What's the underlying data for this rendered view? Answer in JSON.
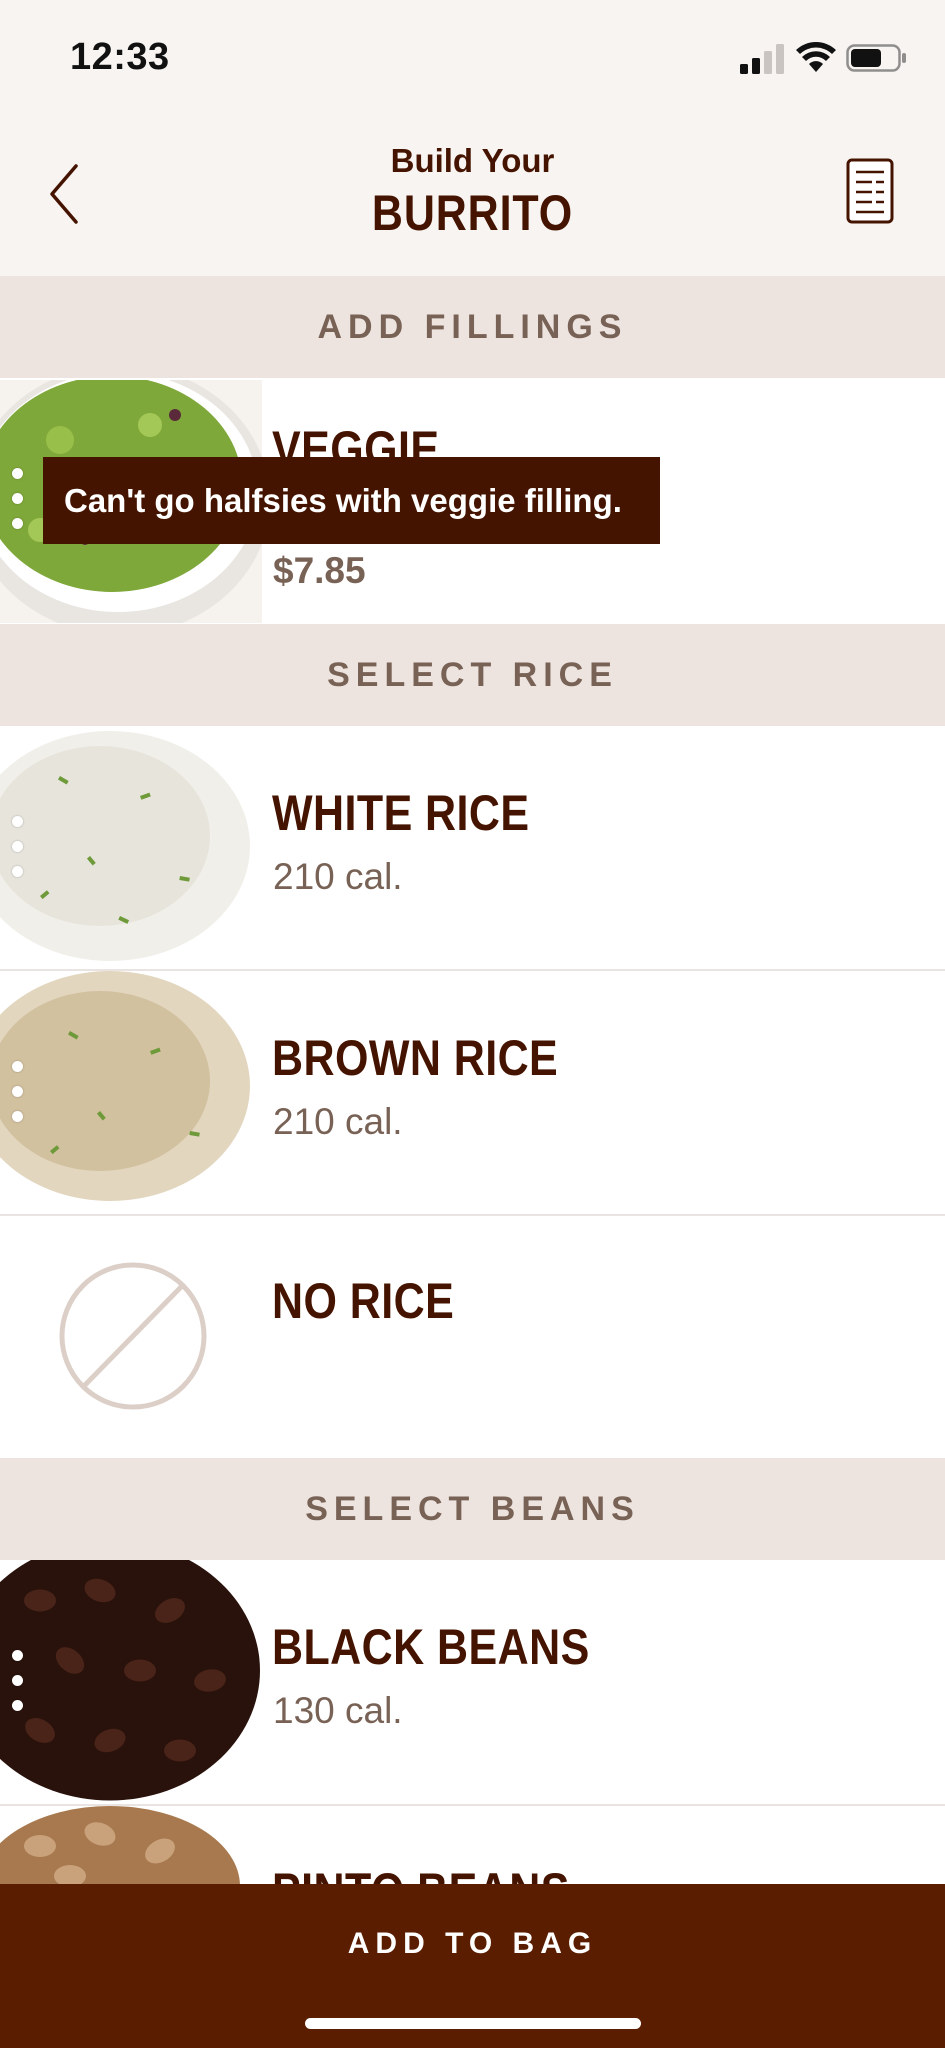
{
  "status_bar": {
    "time": "12:33"
  },
  "header": {
    "subtitle": "Build Your",
    "title": "BURRITO"
  },
  "sections": {
    "fillings": "ADD FILLINGS",
    "rice": "SELECT RICE",
    "beans": "SELECT BEANS"
  },
  "fillings": {
    "veggie": {
      "name": "VEGGIE",
      "price": "$7.85"
    }
  },
  "tooltip": {
    "text": "Can't go halfsies with veggie filling."
  },
  "rice": {
    "white": {
      "name": "WHITE RICE",
      "cal": "210 cal."
    },
    "brown": {
      "name": "BROWN RICE",
      "cal": "210 cal."
    },
    "none": {
      "name": "NO RICE"
    }
  },
  "beans": {
    "black": {
      "name": "BLACK BEANS",
      "cal": "130 cal."
    },
    "pinto": {
      "name": "PINTO BEANS"
    }
  },
  "footer": {
    "add_to_bag": "ADD TO BAG"
  },
  "colors": {
    "brand_brown": "#451400",
    "footer_brown": "#5a1d00",
    "section_bg": "#ede4df",
    "muted_text": "#786155"
  }
}
